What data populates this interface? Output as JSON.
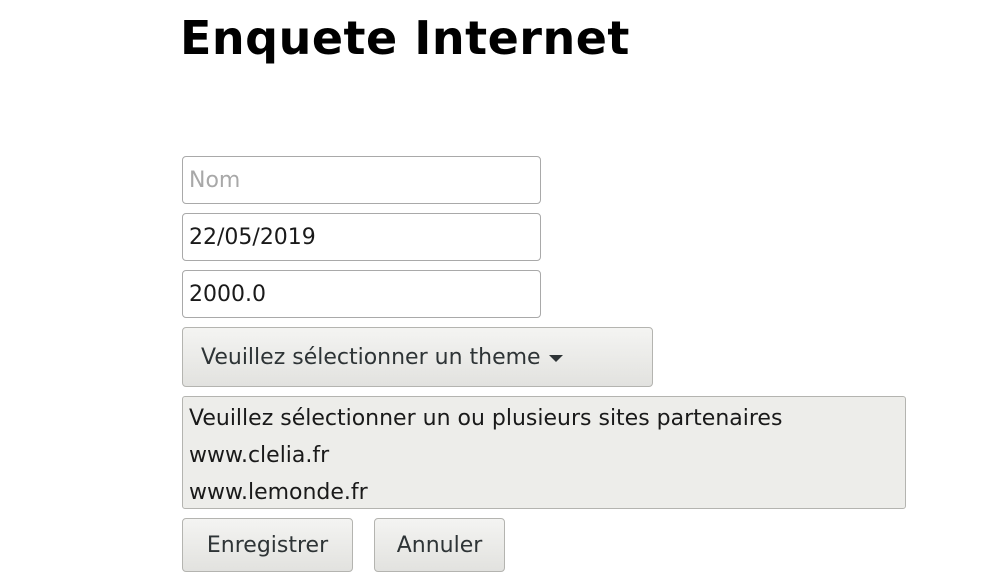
{
  "page": {
    "title": "Enquete Internet"
  },
  "form": {
    "name_field": {
      "value": "",
      "placeholder": "Nom"
    },
    "date_field": {
      "value": "22/05/2019",
      "placeholder": ""
    },
    "amount_field": {
      "value": "2000.0",
      "placeholder": ""
    },
    "theme_select": {
      "selected_label": "Veuillez sélectionner un theme"
    },
    "partner_list": {
      "options": [
        "Veuillez sélectionner un ou plusieurs sites partenaires",
        "www.clelia.fr",
        "www.lemonde.fr"
      ]
    },
    "buttons": {
      "save_label": "Enregistrer",
      "cancel_label": "Annuler"
    }
  },
  "icons": {
    "dropdown": "chevron-down-icon"
  }
}
